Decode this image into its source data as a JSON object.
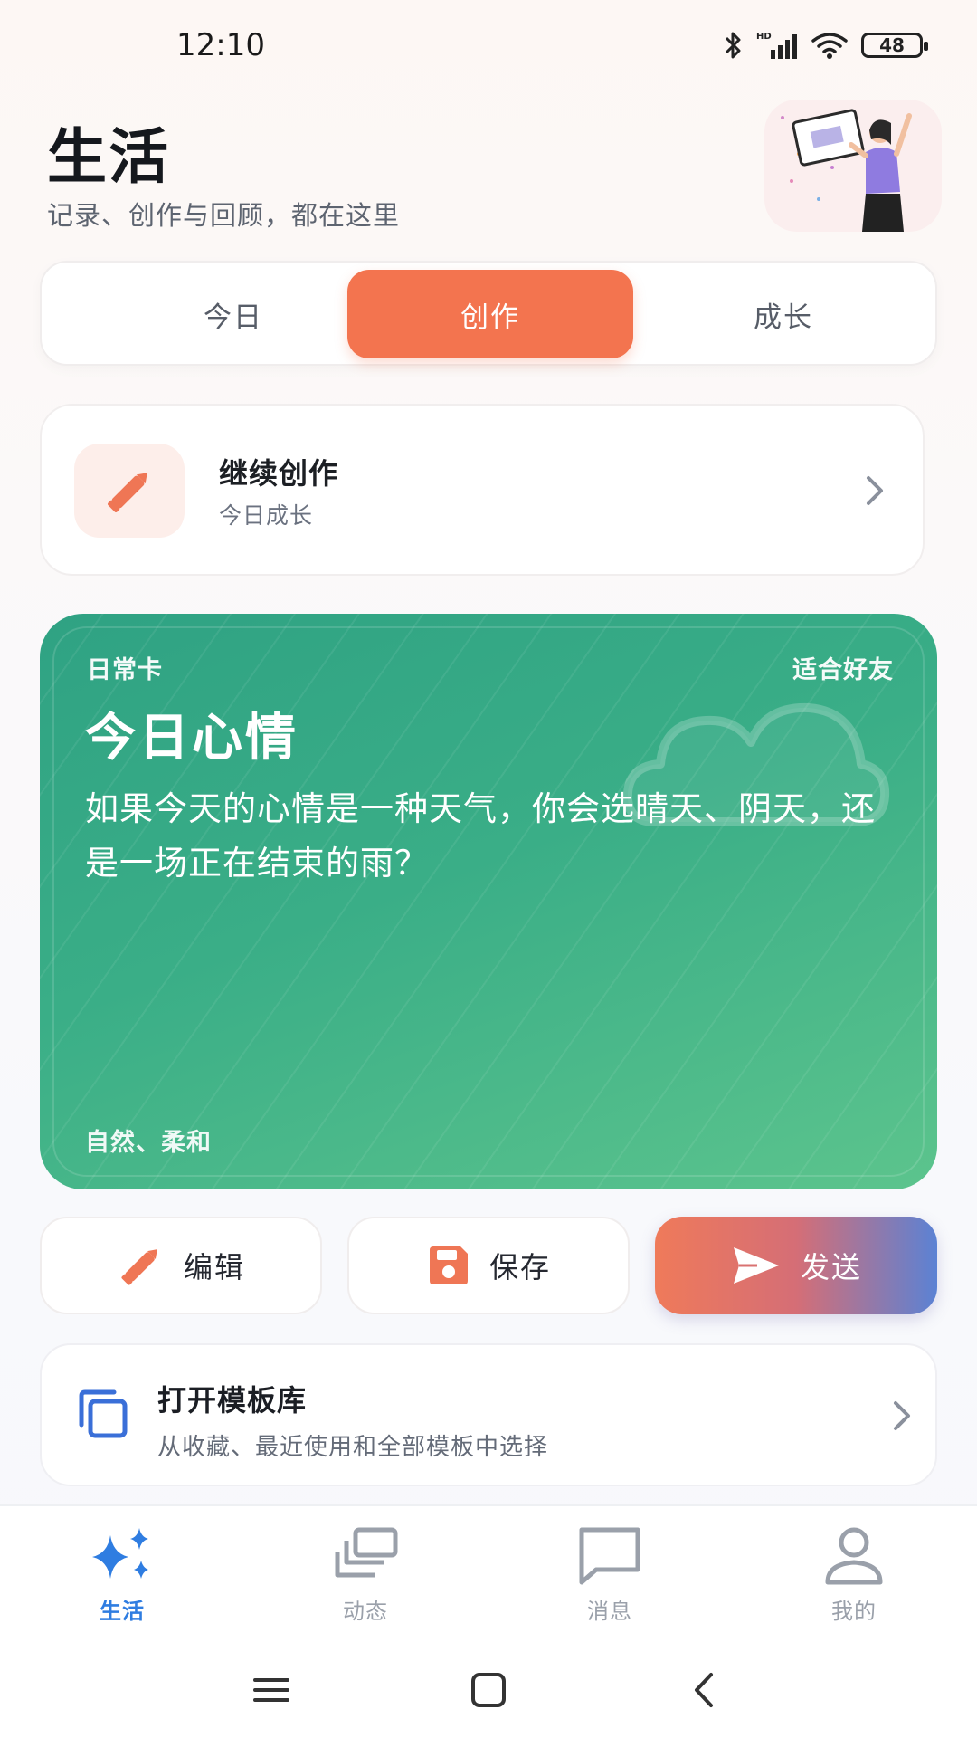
{
  "status_bar": {
    "time": "12:10",
    "network_badge": "HD",
    "battery_level": "48"
  },
  "header": {
    "title": "生活",
    "subtitle": "记录、创作与回顾，都在这里"
  },
  "tabs": [
    {
      "label": "今日",
      "active": false
    },
    {
      "label": "创作",
      "active": true
    },
    {
      "label": "成长",
      "active": false
    }
  ],
  "continue_card": {
    "title": "继续创作",
    "subtitle": "今日成长",
    "icon": "pencil-icon"
  },
  "mood_card": {
    "tag": "日常卡",
    "audience": "适合好友",
    "title": "今日心情",
    "body": "如果今天的心情是一种天气，你会选晴天、阴天，还是一场正在结束的雨？",
    "footer": "自然、柔和",
    "colors": {
      "start": "#2fa283",
      "end": "#5cc48d"
    }
  },
  "actions": {
    "edit_label": "编辑",
    "save_label": "保存",
    "send_label": "发送"
  },
  "template_library": {
    "title": "打开模板库",
    "subtitle": "从收藏、最近使用和全部模板中选择"
  },
  "bottom_nav": [
    {
      "label": "生活",
      "icon": "sparkles-icon",
      "active": true
    },
    {
      "label": "动态",
      "icon": "stack-icon",
      "active": false
    },
    {
      "label": "消息",
      "icon": "chat-bubble-icon",
      "active": false
    },
    {
      "label": "我的",
      "icon": "person-icon",
      "active": false
    }
  ],
  "colors": {
    "accent": "#f3744f",
    "active_nav": "#2f7de1",
    "template_icon": "#3a6fd8"
  }
}
